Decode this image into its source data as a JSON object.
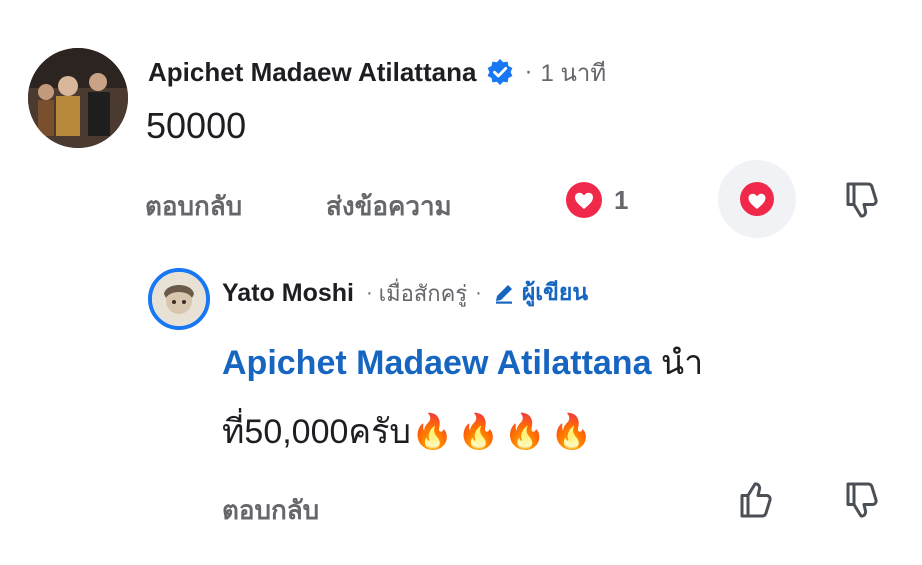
{
  "comment": {
    "author": "Apichet Madaew Atilattana",
    "separator": "·",
    "time": "1 นาที",
    "text": "50000",
    "actions": {
      "reply": "ตอบกลับ",
      "message": "ส่งข้อความ",
      "reaction_count": "1"
    },
    "icons": {
      "verified": "verified-badge-icon",
      "heart": "heart-reaction-icon",
      "dislike": "thumbs-down-icon"
    }
  },
  "reply": {
    "author": "Yato Moshi",
    "separator": "·",
    "time": "เมื่อสักครู่",
    "separator2": "·",
    "author_badge": "ผู้เขียน",
    "mention": "Apichet Madaew Atilattana",
    "text_line1_suffix": " นำ",
    "text_line2": "ที่50,000ครับ",
    "emojis": "🔥🔥🔥🔥",
    "actions": {
      "reply": "ตอบกลับ"
    },
    "icons": {
      "pen": "pen-icon",
      "like": "thumbs-up-icon",
      "dislike": "thumbs-down-icon"
    }
  },
  "colors": {
    "name": "#1c1e21",
    "meta": "#65676b",
    "mention": "#1665c1",
    "verified": "#1877f2",
    "heart": "#f0284a"
  }
}
